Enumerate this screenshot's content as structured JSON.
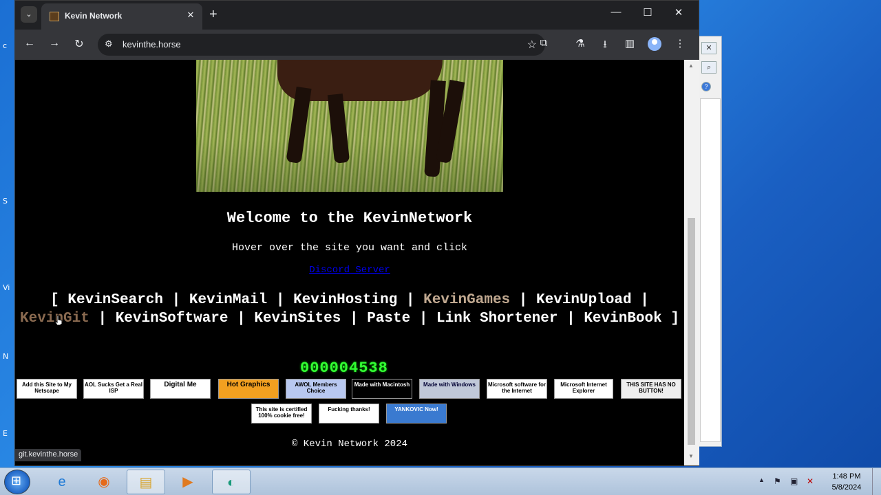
{
  "desktop": {
    "letters": [
      "c",
      "S",
      "Vi",
      "N",
      "E"
    ]
  },
  "browser": {
    "tab_title": "Kevin Network",
    "url": "kevinthe.horse",
    "status_url": "git.kevinthe.horse",
    "icons": [
      "tab-search-icon",
      "close-icon",
      "plus-icon",
      "minimize-icon",
      "maximize-icon",
      "back-icon",
      "forward-icon",
      "reload-icon",
      "site-info-icon",
      "star-icon",
      "extensions-icon",
      "labs-icon",
      "download-icon",
      "side-panel-icon",
      "profile-icon",
      "menu-icon"
    ]
  },
  "page": {
    "welcome": "Welcome to the KevinNetwork",
    "hover_text": "Hover over the site you want and click",
    "discord": "Discord Server",
    "nav_open": "[",
    "nav_close": "]",
    "separator": "|",
    "links": [
      "KevinSearch",
      "KevinMail",
      "KevinHosting",
      "KevinGames",
      "KevinUpload",
      "KevinGit",
      "KevinSoftware",
      "KevinSites",
      "Paste",
      "Link Shortener",
      "KevinBook"
    ],
    "counter": "000004538",
    "badges_row1": [
      "Add this Site to My Netscape",
      "AOL Sucks Get a Real ISP",
      "Digital Me",
      "Hot Graphics",
      "AWOL Members Choice",
      "Made with Macintosh",
      "Made with Windows",
      "Microsoft software for the Internet",
      "Microsoft Internet Explorer",
      "THIS SITE HAS NO BUTTON!"
    ],
    "badges_row2": [
      "This site is certified 100% cookie free!",
      "Fucking thanks!",
      "YANKOVIC Now!"
    ],
    "copyright": "© Kevin Network 2024"
  },
  "taskbar": {
    "apps": [
      "Internet Explorer",
      "Firefox",
      "File Explorer",
      "Media Player",
      "Chrome"
    ],
    "time": "1:48 PM",
    "date": "5/8/2024"
  }
}
